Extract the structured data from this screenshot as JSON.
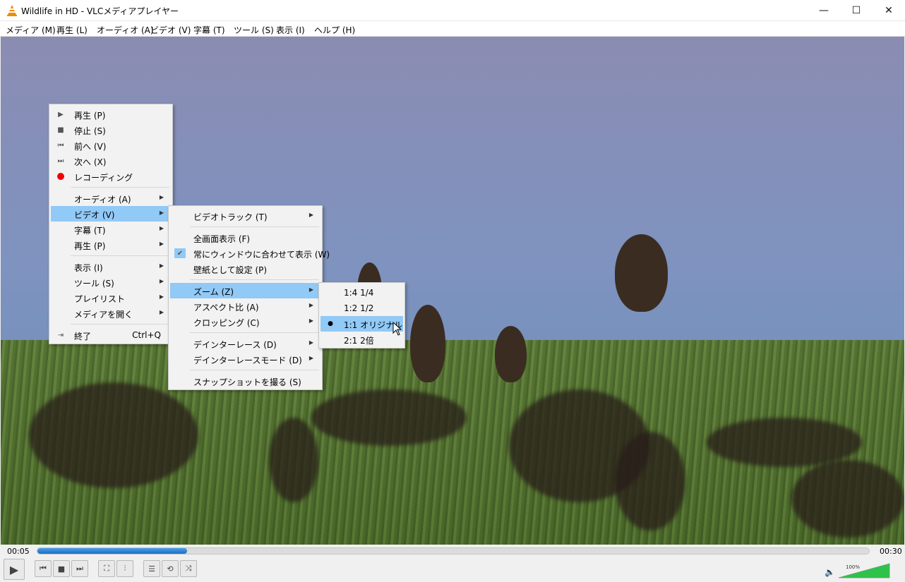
{
  "window": {
    "title": "Wildlife in HD - VLCメディアプレイヤー",
    "controls": {
      "minimize": "—",
      "maximize": "☐",
      "close": "✕"
    }
  },
  "menubar": [
    "メディア (M)",
    "再生 (L)",
    "オーディオ (A)",
    "ビデオ (V)",
    "字幕 (T)",
    "ツール (S)",
    "表示 (I)",
    "ヘルプ (H)"
  ],
  "context_menu": {
    "items": [
      {
        "label": "再生 (P)",
        "icon": "play-icon"
      },
      {
        "label": "停止 (S)",
        "icon": "stop-icon"
      },
      {
        "label": "前へ (V)",
        "icon": "previous-icon"
      },
      {
        "label": "次へ (X)",
        "icon": "next-icon"
      },
      {
        "label": "レコーディング",
        "icon": "record-icon"
      },
      {
        "label": "オーディオ (A)"
      },
      {
        "label": "ビデオ (V)"
      },
      {
        "label": "字幕 (T)"
      },
      {
        "label": "再生 (P)"
      },
      {
        "label": "表示 (I)"
      },
      {
        "label": "ツール (S)"
      },
      {
        "label": "プレイリスト"
      },
      {
        "label": "メディアを開く"
      },
      {
        "label": "終了",
        "shortcut": "Ctrl+Q",
        "icon": "exit-icon"
      }
    ]
  },
  "video_submenu": {
    "items": [
      {
        "label": "ビデオトラック (T)"
      },
      {
        "label": "全画面表示 (F)"
      },
      {
        "label": "常にウィンドウに合わせて表示 (W)",
        "checked": true
      },
      {
        "label": "壁紙として設定 (P)"
      },
      {
        "label": "ズーム (Z)"
      },
      {
        "label": "アスペクト比 (A)"
      },
      {
        "label": "クロッピング (C)"
      },
      {
        "label": "デインターレース (D)"
      },
      {
        "label": "デインターレースモード (D)"
      },
      {
        "label": "スナップショットを撮る (S)"
      }
    ]
  },
  "zoom_submenu": {
    "items": [
      {
        "label": "1:4 1/4"
      },
      {
        "label": "1:2 1/2"
      },
      {
        "label": "1:1 オリジナル",
        "selected": true
      },
      {
        "label": "2:1 2倍"
      }
    ]
  },
  "player": {
    "elapsed": "00:05",
    "total": "00:30",
    "progress_fraction": 0.18,
    "volume_label": "100%",
    "volume_fraction": 1.0
  }
}
